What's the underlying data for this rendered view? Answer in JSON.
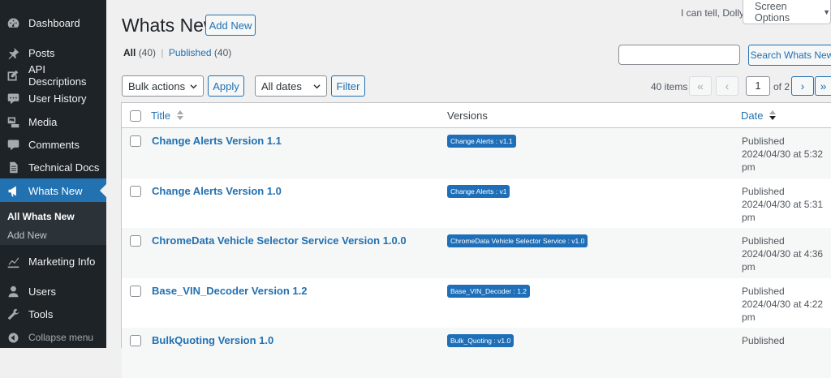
{
  "sidebar": {
    "items": [
      {
        "label": "Dashboard",
        "icon": "dashboard-icon"
      },
      {
        "label": "Posts",
        "icon": "pin-icon"
      },
      {
        "label": "API Descriptions",
        "icon": "edit-icon"
      },
      {
        "label": "User History",
        "icon": "comment-icon"
      },
      {
        "label": "Media",
        "icon": "media-icon"
      },
      {
        "label": "Comments",
        "icon": "comment-icon"
      },
      {
        "label": "Technical Docs",
        "icon": "document-icon"
      },
      {
        "label": "Whats New",
        "icon": "megaphone-icon"
      },
      {
        "label": "Marketing Info",
        "icon": "chart-icon"
      },
      {
        "label": "Users",
        "icon": "users-icon"
      },
      {
        "label": "Tools",
        "icon": "wrench-icon"
      }
    ],
    "submenu": [
      "All Whats New",
      "Add New"
    ],
    "collapse": "Collapse menu"
  },
  "header": {
    "title": "Whats New",
    "add_new": "Add New",
    "greeting": "I can tell, Dolly",
    "screen_options": "Screen Options"
  },
  "views": {
    "all": "All",
    "all_count": "(40)",
    "sep": "|",
    "published": "Published",
    "published_count": "(40)"
  },
  "search": {
    "button": "Search Whats New"
  },
  "toolbar": {
    "bulk_actions": "Bulk actions",
    "apply": "Apply",
    "dates": "All dates",
    "filter": "Filter",
    "items_count": "40 items",
    "first": "«",
    "prev": "‹",
    "current_page": "1",
    "of_pages": "of 2",
    "next": "›",
    "last": "»"
  },
  "table": {
    "columns": {
      "title": "Title",
      "versions": "Versions",
      "date": "Date"
    },
    "rows": [
      {
        "title": "Change Alerts Version 1.1",
        "version": "Change Alerts : v1.1",
        "status": "Published",
        "date": "2024/04/30 at 5:32",
        "time_suffix": "pm"
      },
      {
        "title": "Change Alerts Version 1.0",
        "version": "Change Alerts : v1",
        "status": "Published",
        "date": "2024/04/30 at 5:31",
        "time_suffix": "pm"
      },
      {
        "title": "ChromeData Vehicle Selector Service Version 1.0.0",
        "version": "ChromeData Vehicle Selector Service : v1.0",
        "status": "Published",
        "date": "2024/04/30 at 4:36",
        "time_suffix": "pm"
      },
      {
        "title": "Base_VIN_Decoder Version 1.2",
        "version": "Base_VIN_Decoder : 1.2",
        "status": "Published",
        "date": "2024/04/30 at 4:22",
        "time_suffix": "pm"
      },
      {
        "title": "BulkQuoting Version 1.0",
        "version": "Bulk_Quoting : v1.0",
        "status": "Published",
        "date": "",
        "time_suffix": ""
      }
    ]
  },
  "colors": {
    "sidebar_bg": "#1d2327",
    "accent": "#2271b1",
    "badge": "#1e6fb8"
  }
}
